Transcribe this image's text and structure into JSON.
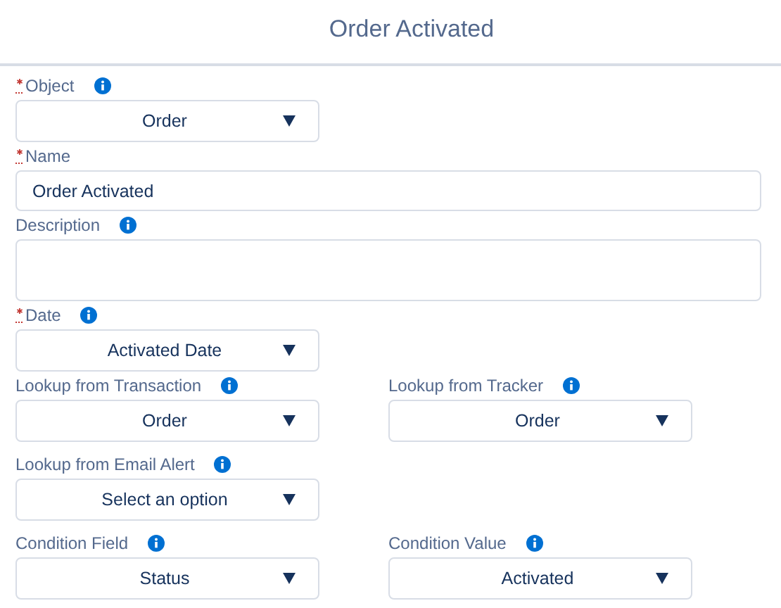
{
  "title": "Order Activated",
  "rows": [
    [
      {
        "label": "Object",
        "required": true,
        "info": true,
        "kind": "select",
        "value": "Order"
      }
    ],
    [
      {
        "label": "Name",
        "required": true,
        "info": false,
        "kind": "text",
        "value": "Order Activated"
      }
    ],
    [
      {
        "label": "Description",
        "required": false,
        "info": true,
        "kind": "textarea"
      }
    ],
    [
      {
        "label": "Date",
        "required": true,
        "info": true,
        "kind": "select",
        "value": "Activated Date"
      }
    ],
    [
      {
        "label": "Lookup from Transaction",
        "required": false,
        "info": true,
        "kind": "select",
        "value": "Order"
      },
      {
        "label": "Lookup from Tracker",
        "required": false,
        "info": true,
        "kind": "select",
        "value": "Order"
      }
    ],
    [
      {
        "label": "Lookup from Email Alert",
        "required": false,
        "info": true,
        "kind": "select",
        "value": "Select an option"
      }
    ],
    [
      {
        "label": "Condition Field",
        "required": false,
        "info": true,
        "kind": "select",
        "value": "Status"
      },
      {
        "label": "Condition Value",
        "required": false,
        "info": true,
        "kind": "select",
        "value": "Activated"
      }
    ]
  ]
}
